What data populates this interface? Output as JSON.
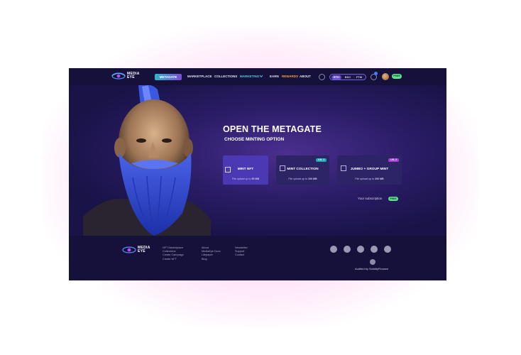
{
  "header": {
    "logo_text_1": "MEDIA",
    "logo_text_2": "EYE",
    "metagate": "METAGATE",
    "nav": [
      "MARKETPLACE",
      "COLLECTIONS",
      "MARKETING",
      "EARN",
      "REWARDS",
      "ABOUT"
    ],
    "chains": [
      "ETH",
      "BSC",
      "FTM"
    ],
    "plan_badge": "FREE"
  },
  "hero": {
    "title": "OPEN THE METAGATE",
    "subtitle": "CHOOSE MINTING OPTION",
    "cards": [
      {
        "title": "MINT NFT",
        "sub_prefix": "File upload up to ",
        "sub_value": "50 MB",
        "badge": ""
      },
      {
        "title": "MINT COLLECTION",
        "sub_prefix": "File upload up to ",
        "sub_value": "100 MB",
        "badge": "LVL 1"
      },
      {
        "title": "JUMBO + GROUP MINT",
        "sub_prefix": "File upload up to ",
        "sub_value": "200 MB",
        "badge": "LVL 2"
      }
    ],
    "subscription_label": "Your subscription",
    "subscription_value": "FREE"
  },
  "footer": {
    "col1": [
      "NFT Marketplace",
      "Collections",
      "Create Campaign",
      "Create NFT"
    ],
    "col2": [
      "About",
      "MediaEye Docs",
      "Litepaper",
      "Blog"
    ],
    "col3": [
      "Newsletter",
      "Support",
      "Contact"
    ],
    "socials": [
      "telegram-icon",
      "twitter-icon",
      "discord-icon",
      "instagram-icon",
      "medium-icon"
    ],
    "audited": "Audited by SolidityFinance"
  },
  "colors": {
    "accent_cyan": "#52c9e3",
    "rewards_orange": "#f7a23a",
    "free_green": "#5ee28f",
    "selected_card": "#4a39b3"
  }
}
